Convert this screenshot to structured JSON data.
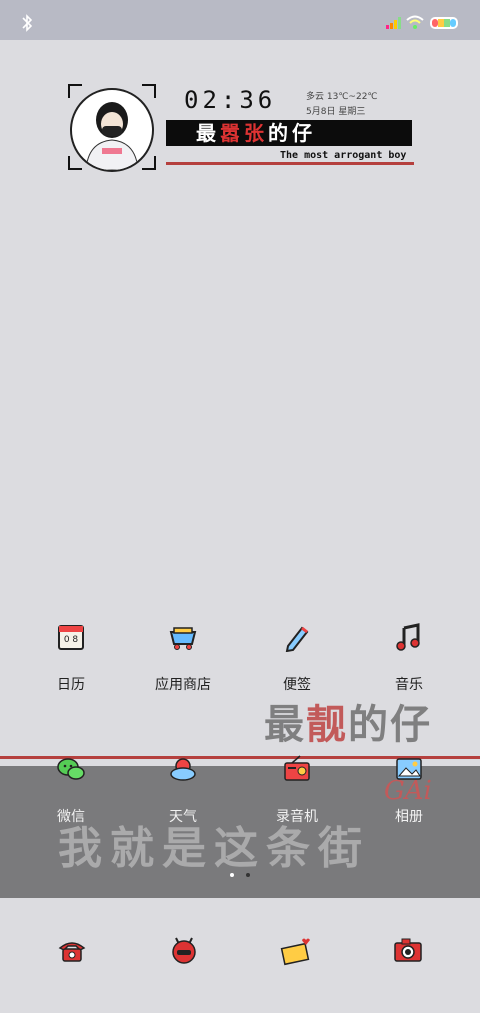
{
  "status_bar": {
    "bluetooth_icon": "bluetooth-icon",
    "signal_icon": "signal-icon",
    "wifi_icon": "wifi-icon",
    "battery_icon": "battery-icon"
  },
  "widget": {
    "time": "02:36",
    "weather": "多云 13℃~22℃",
    "date": "5月8日 星期三",
    "title_part1": "最",
    "title_part2": "嚣张",
    "title_part3": "的仔",
    "subtitle": "The most arrogant boy"
  },
  "apps": [
    {
      "label": "日历",
      "icon": "calendar-icon"
    },
    {
      "label": "应用商店",
      "icon": "app-store-icon"
    },
    {
      "label": "便签",
      "icon": "notes-icon"
    },
    {
      "label": "音乐",
      "icon": "music-icon"
    },
    {
      "label": "微信",
      "icon": "wechat-icon"
    },
    {
      "label": "天气",
      "icon": "weather-icon"
    },
    {
      "label": "录音机",
      "icon": "recorder-icon"
    },
    {
      "label": "相册",
      "icon": "gallery-icon"
    }
  ],
  "wallpaper_text": {
    "line1_a": "最",
    "line1_b": "靓",
    "line1_c": "的仔",
    "line2": "我就是这条街",
    "gai": "GAi"
  },
  "dock": [
    {
      "icon": "phone-icon"
    },
    {
      "icon": "messages-icon"
    },
    {
      "icon": "mail-icon"
    },
    {
      "icon": "camera-icon"
    }
  ],
  "colors": {
    "accent_red": "#b5403e",
    "status_bar": "#b8bac5",
    "background": "#dcdce0"
  }
}
